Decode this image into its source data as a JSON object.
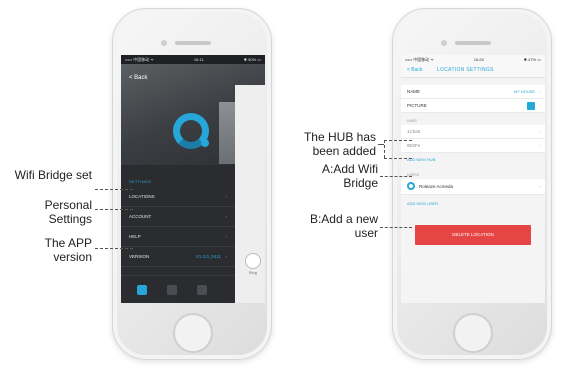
{
  "left_phone": {
    "status": {
      "carrier": "••••• 中国移动 ᯤ",
      "time": "16:11",
      "battery": "✱ 50% ▭"
    },
    "back_label": "< Back",
    "menu": {
      "section_title": "SETTINGS",
      "items": [
        {
          "label": "LOCATIONS",
          "value": ""
        },
        {
          "label": "ACCOUNT",
          "value": ""
        },
        {
          "label": "HELP",
          "value": ""
        },
        {
          "label": "VERSION",
          "value": "V1.0.0_0411"
        }
      ]
    },
    "side_label": "Ring"
  },
  "right_phone": {
    "status": {
      "carrier": "••••• 中国移动 ᯤ",
      "time": "16:28",
      "battery": "✱ 47% ▭"
    },
    "back_label": "< Back",
    "title": "LOCATION SETTINGS",
    "rows": {
      "name_label": "NAME",
      "name_value": "MY HOUSE",
      "picture_label": "PICTURE",
      "hub_section": "HUBS",
      "hubs": [
        "1Cba0",
        "8E0Fe"
      ],
      "add_hub": "ADD NEW HUB",
      "users_section": "USERS",
      "user_name": "Roleaze Acmeda",
      "add_user": "ADD NEW USER",
      "delete_button": "DELETE LOCATION"
    }
  },
  "annotations": {
    "wifi_bridge_set": "Wifi Bridge set",
    "personal_settings": "Personal Settings",
    "app_version": "The APP version",
    "hub_added": "The HUB has been added",
    "add_wifi_bridge": "A:Add Wifi Bridge",
    "add_user": "B:Add a new user"
  },
  "colors": {
    "accent": "#27a7d9",
    "danger": "#e64545",
    "dark_panel": "#2a2c30"
  }
}
